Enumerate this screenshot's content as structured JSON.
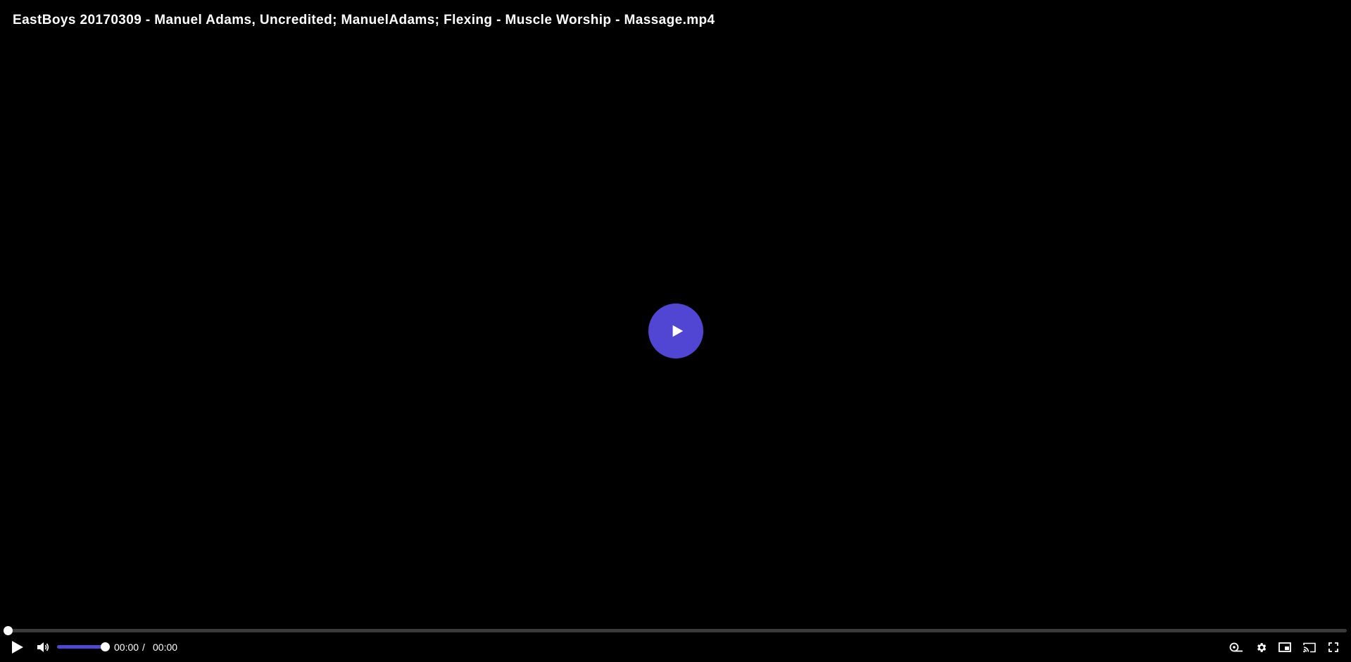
{
  "player": {
    "title": "EastBoys 20170309 - Manuel Adams, Uncredited; ManuelAdams; Flexing - Muscle Worship - Massage.mp4",
    "accent_color": "#5046d3",
    "big_play_icon": "play-icon",
    "progress_fraction": 0.0,
    "volume_fraction": 1.0,
    "current_time": "00:00",
    "time_separator": "/",
    "duration": "00:00",
    "icons": {
      "play": "play-icon",
      "volume": "volume-icon",
      "captions": "captions-icon",
      "settings": "gear-icon",
      "pip": "picture-in-picture-icon",
      "cast": "cast-icon",
      "fullscreen": "fullscreen-icon"
    }
  }
}
